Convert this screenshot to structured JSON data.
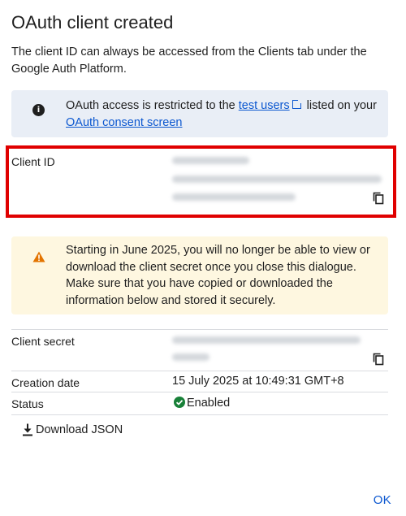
{
  "dialog": {
    "title": "OAuth client created",
    "description": "The client ID can always be accessed from the Clients tab under the Google Auth Platform.",
    "info": {
      "icon": "info-icon",
      "text_before": "OAuth access is restricted to the ",
      "link1": "test users",
      "text_middle": " listed on your ",
      "link2": "OAuth consent screen"
    },
    "client_id": {
      "label": "Client ID",
      "value": ""
    },
    "warning": {
      "icon": "warning-icon",
      "text": "Starting in June 2025, you will no longer be able to view or download the client secret once you close this dialogue. Make sure that you have copied or downloaded the information below and stored it securely."
    },
    "client_secret": {
      "label": "Client secret",
      "value": ""
    },
    "creation_date": {
      "label": "Creation date",
      "value": "15 July 2025 at 10:49:31 GMT+8"
    },
    "status": {
      "label": "Status",
      "value": "Enabled",
      "icon": "check-circle-icon",
      "color": "#188038"
    },
    "download_label": "Download JSON",
    "ok_label": "OK"
  },
  "colors": {
    "link": "#0b57d0",
    "highlight_border": "#e00000",
    "info_bg": "#e9eef6",
    "warning_bg": "#fef7e0",
    "warning_icon": "#e37400"
  }
}
